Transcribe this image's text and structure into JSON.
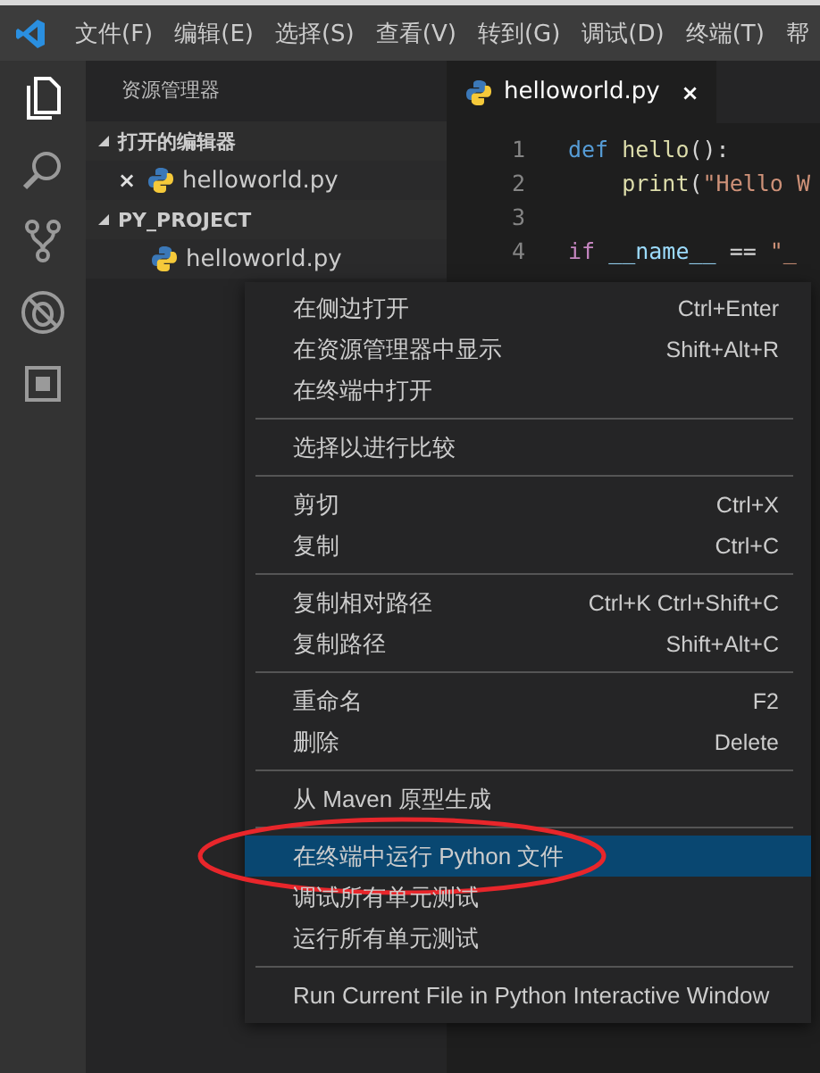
{
  "menu_bar": {
    "items": [
      "文件(F)",
      "编辑(E)",
      "选择(S)",
      "查看(V)",
      "转到(G)",
      "调试(D)",
      "终端(T)",
      "帮"
    ]
  },
  "activity_bar": {
    "items": [
      {
        "kind": "files",
        "selected": true
      },
      {
        "kind": "search",
        "selected": false
      },
      {
        "kind": "git",
        "selected": false
      },
      {
        "kind": "debug",
        "selected": false
      },
      {
        "kind": "extensions",
        "selected": false
      }
    ]
  },
  "sidebar": {
    "title": "资源管理器",
    "sections": [
      {
        "title": "打开的编辑器",
        "expanded": true,
        "items": [
          {
            "label": "helloworld.py",
            "close": "×"
          }
        ]
      },
      {
        "title": "PY_PROJECT",
        "expanded": true,
        "items": [
          {
            "label": "helloworld.py"
          }
        ]
      }
    ]
  },
  "editor": {
    "tabs": [
      {
        "label": "helloworld.py",
        "close": "×",
        "selected": true
      }
    ],
    "lines": [
      {
        "number": "1",
        "tokens": [
          {
            "kind": "keyword",
            "text": "def "
          },
          {
            "kind": "function",
            "text": "hello"
          },
          {
            "kind": "plain",
            "text": "():"
          }
        ]
      },
      {
        "number": "2",
        "tokens": [
          {
            "kind": "function",
            "text": "    print"
          },
          {
            "kind": "plain",
            "text": "("
          },
          {
            "kind": "string",
            "text": "\"Hello W"
          }
        ]
      },
      {
        "number": "3"
      },
      {
        "number": "4",
        "tokens": [
          {
            "kind": "control",
            "text": "if "
          },
          {
            "kind": "variable",
            "text": "__name__"
          },
          {
            "kind": "plain",
            "text": " == "
          },
          {
            "kind": "string",
            "text": "\"_"
          }
        ]
      }
    ]
  },
  "context_menu": {
    "groups": [
      [
        {
          "label": "在侧边打开",
          "shortcut": "Ctrl+Enter",
          "selected": false
        },
        {
          "label": "在资源管理器中显示",
          "shortcut": "Shift+Alt+R",
          "selected": false
        },
        {
          "label": "在终端中打开",
          "selected": false
        }
      ],
      [
        {
          "label": "选择以进行比较",
          "selected": false
        }
      ],
      [
        {
          "label": "剪切",
          "shortcut": "Ctrl+X",
          "selected": false
        },
        {
          "label": "复制",
          "shortcut": "Ctrl+C",
          "selected": false
        }
      ],
      [
        {
          "label": "复制相对路径",
          "shortcut": "Ctrl+K Ctrl+Shift+C",
          "selected": false
        },
        {
          "label": "复制路径",
          "shortcut": "Shift+Alt+C",
          "selected": false
        }
      ],
      [
        {
          "label": "重命名",
          "shortcut": "F2",
          "selected": false
        },
        {
          "label": "删除",
          "shortcut": "Delete",
          "selected": false
        }
      ],
      [
        {
          "label": "从 Maven 原型生成",
          "selected": false
        }
      ],
      [
        {
          "label": "在终端中运行 Python 文件",
          "selected": true,
          "circled": true
        },
        {
          "label": "调试所有单元测试",
          "selected": false
        },
        {
          "label": "运行所有单元测试",
          "selected": false
        }
      ],
      [
        {
          "label": "Run Current File in Python Interactive Window",
          "selected": false
        }
      ]
    ]
  }
}
